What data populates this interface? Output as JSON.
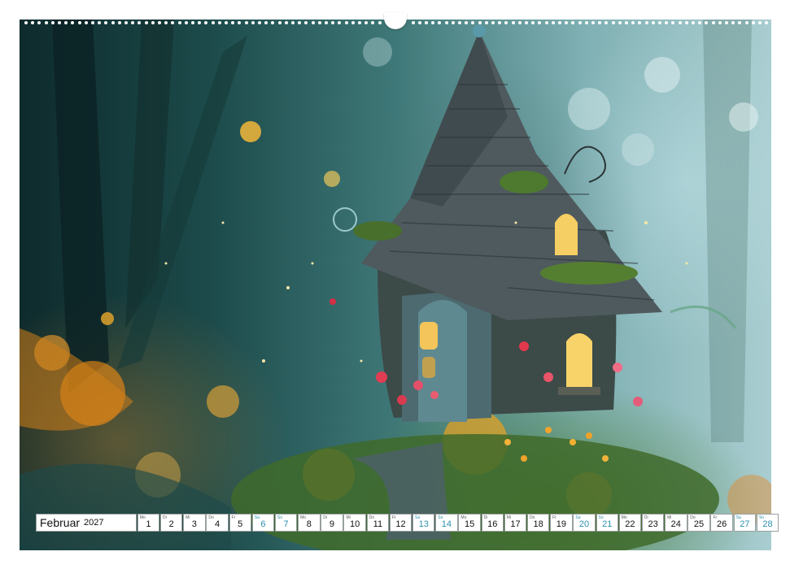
{
  "calendar": {
    "month": "Februar",
    "year": "2027",
    "accent_weekend": "#2a8fb0",
    "days": [
      {
        "wd": "Mo",
        "num": "1",
        "weekend": false
      },
      {
        "wd": "Di",
        "num": "2",
        "weekend": false
      },
      {
        "wd": "Mi",
        "num": "3",
        "weekend": false
      },
      {
        "wd": "Do",
        "num": "4",
        "weekend": false
      },
      {
        "wd": "Fr",
        "num": "5",
        "weekend": false
      },
      {
        "wd": "Sa",
        "num": "6",
        "weekend": true
      },
      {
        "wd": "So",
        "num": "7",
        "weekend": true
      },
      {
        "wd": "Mo",
        "num": "8",
        "weekend": false
      },
      {
        "wd": "Di",
        "num": "9",
        "weekend": false
      },
      {
        "wd": "Mi",
        "num": "10",
        "weekend": false
      },
      {
        "wd": "Do",
        "num": "11",
        "weekend": false
      },
      {
        "wd": "Fr",
        "num": "12",
        "weekend": false
      },
      {
        "wd": "Sa",
        "num": "13",
        "weekend": true
      },
      {
        "wd": "So",
        "num": "14",
        "weekend": true
      },
      {
        "wd": "Mo",
        "num": "15",
        "weekend": false
      },
      {
        "wd": "Di",
        "num": "16",
        "weekend": false
      },
      {
        "wd": "Mi",
        "num": "17",
        "weekend": false
      },
      {
        "wd": "Do",
        "num": "18",
        "weekend": false
      },
      {
        "wd": "Fr",
        "num": "19",
        "weekend": false
      },
      {
        "wd": "Sa",
        "num": "20",
        "weekend": true
      },
      {
        "wd": "So",
        "num": "21",
        "weekend": true
      },
      {
        "wd": "Mo",
        "num": "22",
        "weekend": false
      },
      {
        "wd": "Di",
        "num": "23",
        "weekend": false
      },
      {
        "wd": "Mi",
        "num": "24",
        "weekend": false
      },
      {
        "wd": "Do",
        "num": "25",
        "weekend": false
      },
      {
        "wd": "Fr",
        "num": "26",
        "weekend": false
      },
      {
        "wd": "Sa",
        "num": "27",
        "weekend": true
      },
      {
        "wd": "So",
        "num": "28",
        "weekend": true
      }
    ]
  },
  "photo": {
    "subject": "fairy-house-illustration"
  }
}
